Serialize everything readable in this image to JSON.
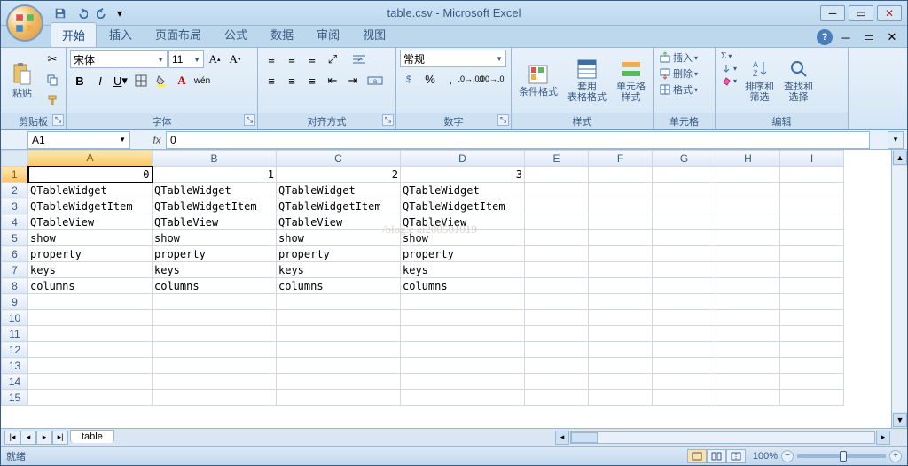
{
  "title": "table.csv - Microsoft Excel",
  "qat": {
    "save": "save",
    "undo": "undo",
    "redo": "redo"
  },
  "tabs": [
    "开始",
    "插入",
    "页面布局",
    "公式",
    "数据",
    "审阅",
    "视图"
  ],
  "activeTab": 0,
  "ribbon": {
    "clipboard": {
      "label": "剪贴板",
      "paste": "粘贴"
    },
    "font": {
      "label": "字体",
      "name": "宋体",
      "size": "11"
    },
    "align": {
      "label": "对齐方式"
    },
    "number": {
      "label": "数字",
      "format": "常规"
    },
    "styles": {
      "label": "样式",
      "cond": "条件格式",
      "table": "套用\n表格格式",
      "cell": "单元格\n样式"
    },
    "cells": {
      "label": "单元格",
      "insert": "插入",
      "delete": "删除",
      "format": "格式"
    },
    "editing": {
      "label": "编辑",
      "sort": "排序和\n筛选",
      "find": "查找和\n选择"
    }
  },
  "namebox": "A1",
  "formula": "0",
  "columns": [
    "A",
    "B",
    "C",
    "D",
    "E",
    "F",
    "G",
    "H",
    "I"
  ],
  "rowCount": 15,
  "cells": {
    "1": {
      "A": {
        "v": "0",
        "num": true
      },
      "B": {
        "v": "1",
        "num": true
      },
      "C": {
        "v": "2",
        "num": true
      },
      "D": {
        "v": "3",
        "num": true
      }
    },
    "2": {
      "A": {
        "v": "QTableWidget"
      },
      "B": {
        "v": "QTableWidget"
      },
      "C": {
        "v": "QTableWidget"
      },
      "D": {
        "v": "QTableWidget"
      }
    },
    "3": {
      "A": {
        "v": "QTableWidgetItem"
      },
      "B": {
        "v": "QTableWidgetItem"
      },
      "C": {
        "v": "QTableWidgetItem"
      },
      "D": {
        "v": "QTableWidgetItem"
      }
    },
    "4": {
      "A": {
        "v": "QTableView"
      },
      "B": {
        "v": "QTableView"
      },
      "C": {
        "v": "QTableView"
      },
      "D": {
        "v": "QTableView"
      }
    },
    "5": {
      "A": {
        "v": "show"
      },
      "B": {
        "v": "show"
      },
      "C": {
        "v": "show"
      },
      "D": {
        "v": "show"
      }
    },
    "6": {
      "A": {
        "v": "property"
      },
      "B": {
        "v": "property"
      },
      "C": {
        "v": "property"
      },
      "D": {
        "v": "property"
      }
    },
    "7": {
      "A": {
        "v": "keys"
      },
      "B": {
        "v": "keys"
      },
      "C": {
        "v": "keys"
      },
      "D": {
        "v": "keys"
      }
    },
    "8": {
      "A": {
        "v": "columns"
      },
      "B": {
        "v": "columns"
      },
      "C": {
        "v": "columns"
      },
      "D": {
        "v": "columns"
      }
    }
  },
  "selectedCell": "A1",
  "sheetTab": "table",
  "status": "就绪",
  "zoom": "100%",
  "watermark": "/blog.c   ai200501019"
}
